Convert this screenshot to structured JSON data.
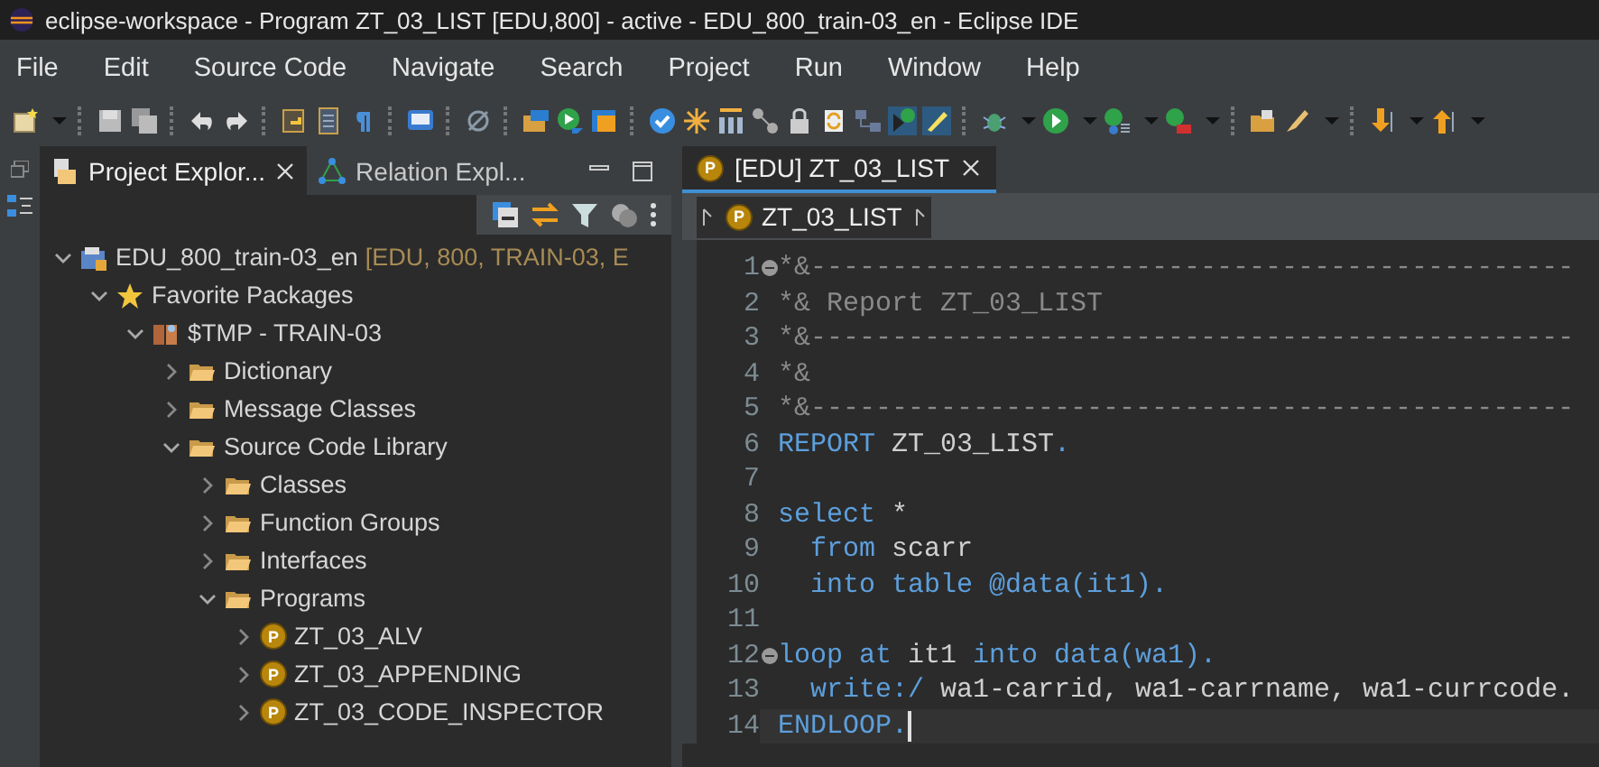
{
  "window": {
    "title": "eclipse-workspace - Program ZT_03_LIST [EDU,800] - active - EDU_800_train-03_en - Eclipse IDE"
  },
  "menu": [
    "File",
    "Edit",
    "Source Code",
    "Navigate",
    "Search",
    "Project",
    "Run",
    "Window",
    "Help"
  ],
  "explorer": {
    "tabs": [
      {
        "label": "Project Explor...",
        "selected": true
      },
      {
        "label": "Relation Expl...",
        "selected": false
      }
    ],
    "tree": [
      {
        "kind": "project",
        "label": "EDU_800_train-03_en",
        "decoration": "[EDU, 800, TRAIN-03, E",
        "expanded": true,
        "children": [
          {
            "kind": "favorites",
            "label": "Favorite Packages",
            "expanded": true,
            "children": [
              {
                "kind": "package",
                "label": "$TMP - TRAIN-03",
                "expanded": true,
                "children": [
                  {
                    "kind": "folder",
                    "label": "Dictionary",
                    "expanded": false
                  },
                  {
                    "kind": "folder",
                    "label": "Message Classes",
                    "expanded": false
                  },
                  {
                    "kind": "folder",
                    "label": "Source Code Library",
                    "expanded": true,
                    "children": [
                      {
                        "kind": "folder",
                        "label": "Classes",
                        "expanded": false
                      },
                      {
                        "kind": "folder",
                        "label": "Function Groups",
                        "expanded": false
                      },
                      {
                        "kind": "folder",
                        "label": "Interfaces",
                        "expanded": false
                      },
                      {
                        "kind": "folder",
                        "label": "Programs",
                        "expanded": true,
                        "children": [
                          {
                            "kind": "program",
                            "icon_letter": "P",
                            "label": "ZT_03_ALV",
                            "expanded": false
                          },
                          {
                            "kind": "program",
                            "icon_letter": "P",
                            "label": "ZT_03_APPENDING",
                            "expanded": false
                          },
                          {
                            "kind": "program",
                            "icon_letter": "P",
                            "label": "ZT_03_CODE_INSPECTOR",
                            "expanded": false
                          }
                        ]
                      }
                    ]
                  }
                ]
              }
            ]
          }
        ]
      }
    ]
  },
  "editor": {
    "tabs": [
      {
        "icon_letter": "P",
        "label": "[EDU] ZT_03_LIST",
        "selected": true
      }
    ],
    "breadcrumb": {
      "icon_letter": "P",
      "label": "ZT_03_LIST"
    },
    "lines": [
      {
        "number": "1",
        "folding": true,
        "current": false,
        "tokens": [
          {
            "kind": "comment",
            "text": "*&-----------------------------------------------"
          }
        ]
      },
      {
        "number": "2",
        "folding": false,
        "current": false,
        "tokens": [
          {
            "kind": "comment",
            "text": "*& Report ZT_03_LIST"
          }
        ]
      },
      {
        "number": "3",
        "folding": false,
        "current": false,
        "tokens": [
          {
            "kind": "comment",
            "text": "*&-----------------------------------------------"
          }
        ]
      },
      {
        "number": "4",
        "folding": false,
        "current": false,
        "tokens": [
          {
            "kind": "comment",
            "text": "*&"
          }
        ]
      },
      {
        "number": "5",
        "folding": false,
        "current": false,
        "tokens": [
          {
            "kind": "comment",
            "text": "*&-----------------------------------------------"
          }
        ]
      },
      {
        "number": "6",
        "folding": false,
        "current": false,
        "tokens": [
          {
            "kind": "keyword",
            "text": "REPORT"
          },
          {
            "kind": "plain",
            "text": " ZT_03_LIST"
          },
          {
            "kind": "keyword",
            "text": "."
          }
        ]
      },
      {
        "number": "7",
        "folding": false,
        "current": false
      },
      {
        "number": "8",
        "folding": false,
        "current": false,
        "tokens": [
          {
            "kind": "keyword",
            "text": "select"
          },
          {
            "kind": "plain",
            "text": " *"
          }
        ]
      },
      {
        "number": "9",
        "folding": false,
        "current": false,
        "tokens": [
          {
            "kind": "keyword",
            "text": "  from"
          },
          {
            "kind": "plain",
            "text": " scarr"
          }
        ]
      },
      {
        "number": "10",
        "folding": false,
        "current": false,
        "tokens": [
          {
            "kind": "keyword",
            "text": "  into table @data(it1)."
          }
        ]
      },
      {
        "number": "11",
        "folding": false,
        "current": false
      },
      {
        "number": "12",
        "folding": true,
        "current": false,
        "tokens": [
          {
            "kind": "keyword",
            "text": "loop at"
          },
          {
            "kind": "plain",
            "text": " it1 "
          },
          {
            "kind": "keyword",
            "text": "into data(wa1)."
          }
        ]
      },
      {
        "number": "13",
        "folding": false,
        "current": false,
        "tokens": [
          {
            "kind": "keyword",
            "text": "  write:/"
          },
          {
            "kind": "plain",
            "text": " wa1-carrid, wa1-carrname, wa1-currcode."
          }
        ]
      },
      {
        "number": "14",
        "folding": false,
        "current": true,
        "tokens": [
          {
            "kind": "keyword",
            "text": "ENDLOOP."
          }
        ]
      }
    ]
  }
}
